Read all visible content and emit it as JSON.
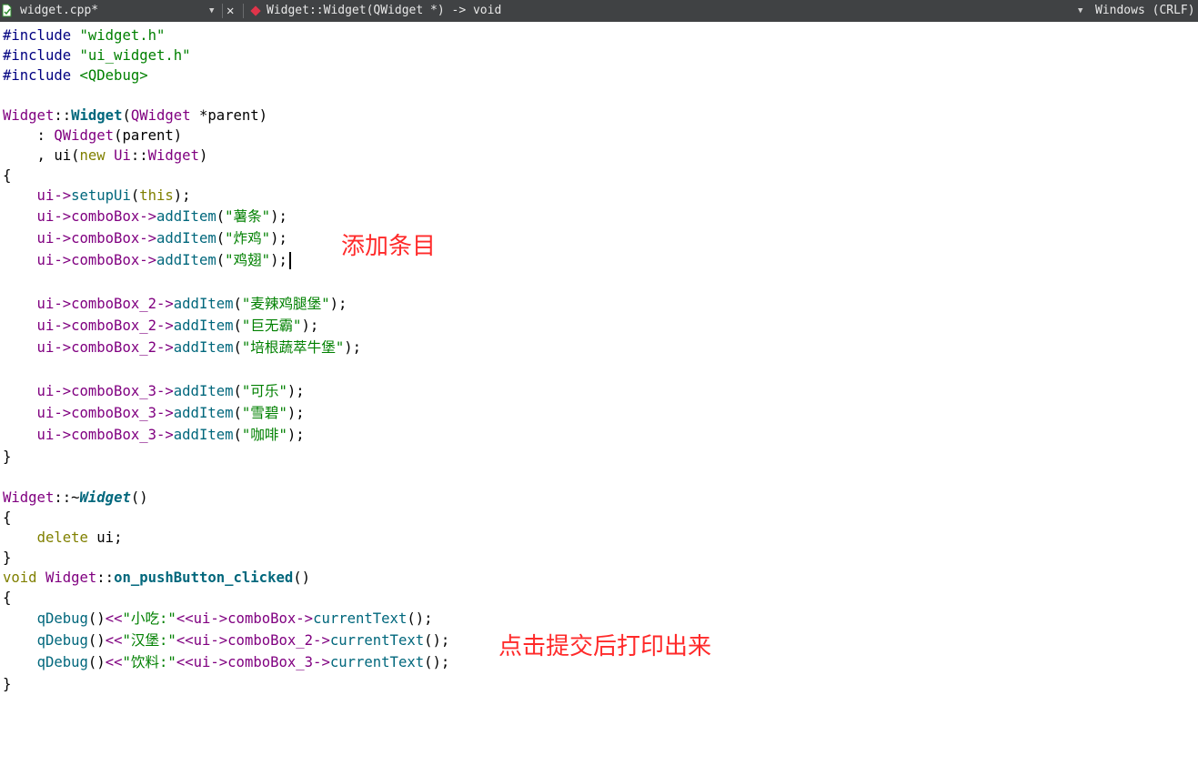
{
  "tab_bar": {
    "file_name": "widget.cpp*",
    "close_glyph": "✕",
    "dropdown_glyph": "▼",
    "function_signature": "Widget::Widget(QWidget *) -> void",
    "line_endings": "Windows (CRLF)"
  },
  "code": {
    "inc1a": "#include ",
    "inc1b": "\"widget.h\"",
    "inc2a": "#include ",
    "inc2b": "\"ui_widget.h\"",
    "inc3a": "#include ",
    "inc3b": "<QDebug>",
    "c1a": "Widget",
    "c1b": "::",
    "c1c": "Widget",
    "c1d": "(",
    "c1e": "QWidget",
    "c1f": " *parent)",
    "c2a": "    : ",
    "c2b": "QWidget",
    "c2c": "(parent)",
    "c3a": "    , ui(",
    "c3b": "new",
    "c3c": " ",
    "c3d": "Ui",
    "c3e": "::",
    "c3f": "Widget",
    "c3g": ")",
    "brace_open": "{",
    "brace_close": "}",
    "su1": "    ui->",
    "su2": "setupUi",
    "su3": "(",
    "su4": "this",
    "su5": ");",
    "ui_prefix": "    ui->",
    "cb1": "comboBox->",
    "cb2": "comboBox_2->",
    "cb3": "comboBox_3->",
    "add": "addItem",
    "paren": "(",
    "end": ");",
    "s_shutiao": "\"薯条\"",
    "s_zhaji": "\"炸鸡\"",
    "s_jichi": "\"鸡翅\"",
    "s_mcj": "\"麦辣鸡腿堡\"",
    "s_jwb": "\"巨无霸\"",
    "s_pgs": "\"培根蔬萃牛堡\"",
    "s_kele": "\"可乐\"",
    "s_xuebi": "\"雪碧\"",
    "s_kafei": "\"咖啡\"",
    "d1a": "Widget",
    "d1b": "::~",
    "d1c": "Widget",
    "d1d": "()",
    "del1": "    ",
    "del2": "delete",
    "del3": " ui;",
    "v1": "void",
    "v2": " ",
    "v3": "Widget",
    "v4": "::",
    "v5": "on_pushButton_clicked",
    "v6": "()",
    "q_ind": "    ",
    "q_fn": "qDebug",
    "q_p": "()",
    "q_op": "<<",
    "q_s1": "\"小吃:\"",
    "q_s2": "\"汉堡:\"",
    "q_s3": "\"饮料:\"",
    "q_op2": "<<ui->",
    "cur": "currentText",
    "cur_end": "();"
  },
  "annotations": {
    "add_items": "添加条目",
    "print_on_submit": "点击提交后打印出来"
  }
}
